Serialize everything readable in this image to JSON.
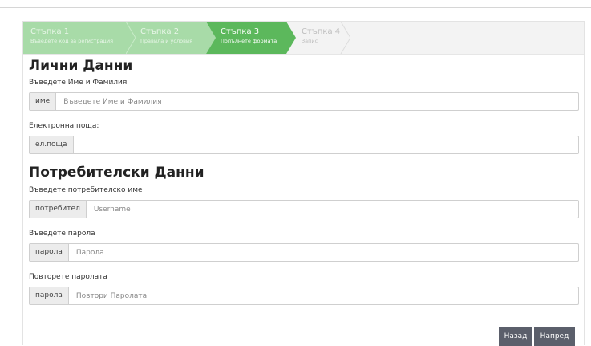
{
  "wizard": {
    "steps": [
      {
        "title": "Стъпка 1",
        "desc": "Въведете код за регистрация"
      },
      {
        "title": "Стъпка 2",
        "desc": "Правила и условия"
      },
      {
        "title": "Стъпка 3",
        "desc": "Попълнете формата"
      },
      {
        "title": "Стъпка 4",
        "desc": "Запис"
      }
    ],
    "current_step": 3,
    "colors": {
      "done": "#a8dba8",
      "current": "#5cb85c",
      "todo": "#f3f3f3"
    }
  },
  "personal": {
    "heading": "Лични Данни",
    "name": {
      "label": "Въведете Име и Фамилия",
      "addon": "име",
      "placeholder": "Въведете Име и Фамилия",
      "value": ""
    },
    "email": {
      "label": "Електронна поща:",
      "addon": "ел.поща",
      "placeholder": "",
      "value": ""
    }
  },
  "account": {
    "heading": "Потребителски Данни",
    "username": {
      "label": "Въведете потребителско име",
      "addon": "потребител",
      "placeholder": "Username",
      "value": ""
    },
    "password": {
      "label": "Въведете парола",
      "addon": "парола",
      "placeholder": "Парола",
      "value": ""
    },
    "password_repeat": {
      "label": "Повторете паролата",
      "addon": "парола",
      "placeholder": "Повтори Паролата",
      "value": ""
    }
  },
  "buttons": {
    "back": "Назад",
    "next": "Напред",
    "color": "#5b5f6b"
  }
}
